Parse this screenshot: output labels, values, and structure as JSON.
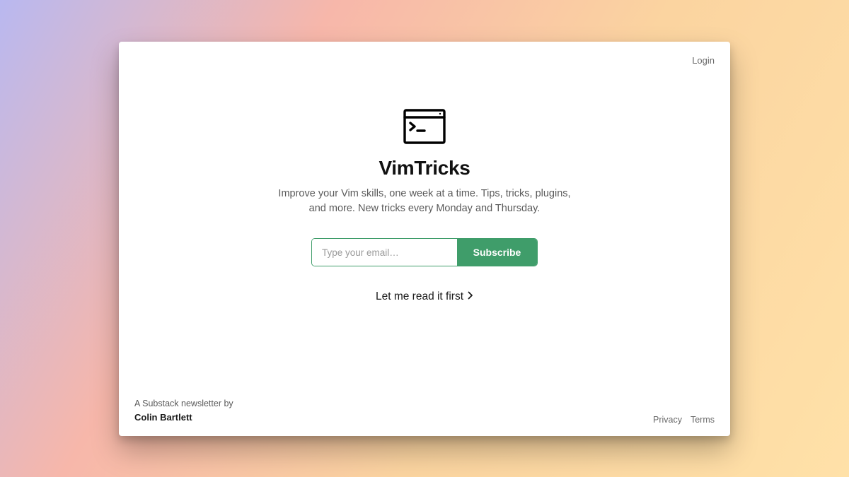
{
  "header": {
    "login_label": "Login"
  },
  "hero": {
    "icon_name": "terminal-window-icon",
    "title": "VimTricks",
    "subtitle": "Improve your Vim skills, one week at a time. Tips, tricks, plugins, and more. New tricks every Monday and Thursday."
  },
  "subscribe": {
    "email_placeholder": "Type your email…",
    "button_label": "Subscribe",
    "accent_color": "#3f9d6a"
  },
  "read_first": {
    "label": "Let me read it first"
  },
  "footer": {
    "byline_prefix": "A Substack newsletter by",
    "author": "Colin Bartlett",
    "privacy_label": "Privacy",
    "terms_label": "Terms"
  }
}
